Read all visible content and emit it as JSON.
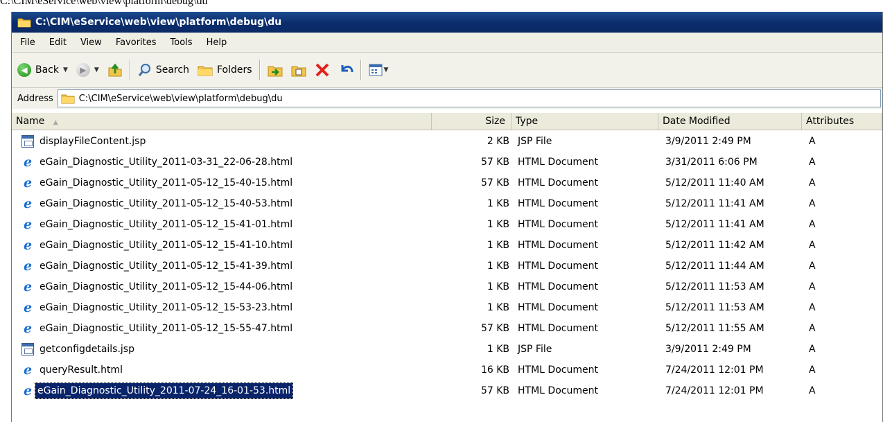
{
  "doc_title": "C:\\CIM\\eService\\web\\view\\platform\\debug\\du",
  "window": {
    "title": "C:\\CIM\\eService\\web\\view\\platform\\debug\\du"
  },
  "menu": {
    "file": "File",
    "edit": "Edit",
    "view": "View",
    "favorites": "Favorites",
    "tools": "Tools",
    "help": "Help"
  },
  "toolbar": {
    "back_label": "Back",
    "search_label": "Search",
    "folders_label": "Folders"
  },
  "address": {
    "label": "Address",
    "value": "C:\\CIM\\eService\\web\\view\\platform\\debug\\du"
  },
  "columns": {
    "name": "Name",
    "size": "Size",
    "type": "Type",
    "date": "Date Modified",
    "attributes": "Attributes"
  },
  "files": [
    {
      "name": "displayFileContent.jsp",
      "size": "2 KB",
      "type": "JSP File",
      "date": "3/9/2011 2:49 PM",
      "attr": "A",
      "icon": "jsp-file-icon"
    },
    {
      "name": "eGain_Diagnostic_Utility_2011-03-31_22-06-28.html",
      "size": "57 KB",
      "type": "HTML Document",
      "date": "3/31/2011 6:06 PM",
      "attr": "A",
      "icon": "ie-html-icon"
    },
    {
      "name": "eGain_Diagnostic_Utility_2011-05-12_15-40-15.html",
      "size": "57 KB",
      "type": "HTML Document",
      "date": "5/12/2011 11:40 AM",
      "attr": "A",
      "icon": "ie-html-icon"
    },
    {
      "name": "eGain_Diagnostic_Utility_2011-05-12_15-40-53.html",
      "size": "1 KB",
      "type": "HTML Document",
      "date": "5/12/2011 11:41 AM",
      "attr": "A",
      "icon": "ie-html-icon"
    },
    {
      "name": "eGain_Diagnostic_Utility_2011-05-12_15-41-01.html",
      "size": "1 KB",
      "type": "HTML Document",
      "date": "5/12/2011 11:41 AM",
      "attr": "A",
      "icon": "ie-html-icon"
    },
    {
      "name": "eGain_Diagnostic_Utility_2011-05-12_15-41-10.html",
      "size": "1 KB",
      "type": "HTML Document",
      "date": "5/12/2011 11:42 AM",
      "attr": "A",
      "icon": "ie-html-icon"
    },
    {
      "name": "eGain_Diagnostic_Utility_2011-05-12_15-41-39.html",
      "size": "1 KB",
      "type": "HTML Document",
      "date": "5/12/2011 11:44 AM",
      "attr": "A",
      "icon": "ie-html-icon"
    },
    {
      "name": "eGain_Diagnostic_Utility_2011-05-12_15-44-06.html",
      "size": "1 KB",
      "type": "HTML Document",
      "date": "5/12/2011 11:53 AM",
      "attr": "A",
      "icon": "ie-html-icon"
    },
    {
      "name": "eGain_Diagnostic_Utility_2011-05-12_15-53-23.html",
      "size": "1 KB",
      "type": "HTML Document",
      "date": "5/12/2011 11:53 AM",
      "attr": "A",
      "icon": "ie-html-icon"
    },
    {
      "name": "eGain_Diagnostic_Utility_2011-05-12_15-55-47.html",
      "size": "57 KB",
      "type": "HTML Document",
      "date": "5/12/2011 11:55 AM",
      "attr": "A",
      "icon": "ie-html-icon"
    },
    {
      "name": "getconfigdetails.jsp",
      "size": "1 KB",
      "type": "JSP File",
      "date": "3/9/2011 2:49 PM",
      "attr": "A",
      "icon": "jsp-file-icon"
    },
    {
      "name": "queryResult.html",
      "size": "16 KB",
      "type": "HTML Document",
      "date": "7/24/2011 12:01 PM",
      "attr": "A",
      "icon": "ie-html-icon"
    },
    {
      "name": "eGain_Diagnostic_Utility_2011-07-24_16-01-53.html",
      "size": "57 KB",
      "type": "HTML Document",
      "date": "7/24/2011 12:01 PM",
      "attr": "A",
      "icon": "ie-html-icon",
      "selected": true
    }
  ]
}
